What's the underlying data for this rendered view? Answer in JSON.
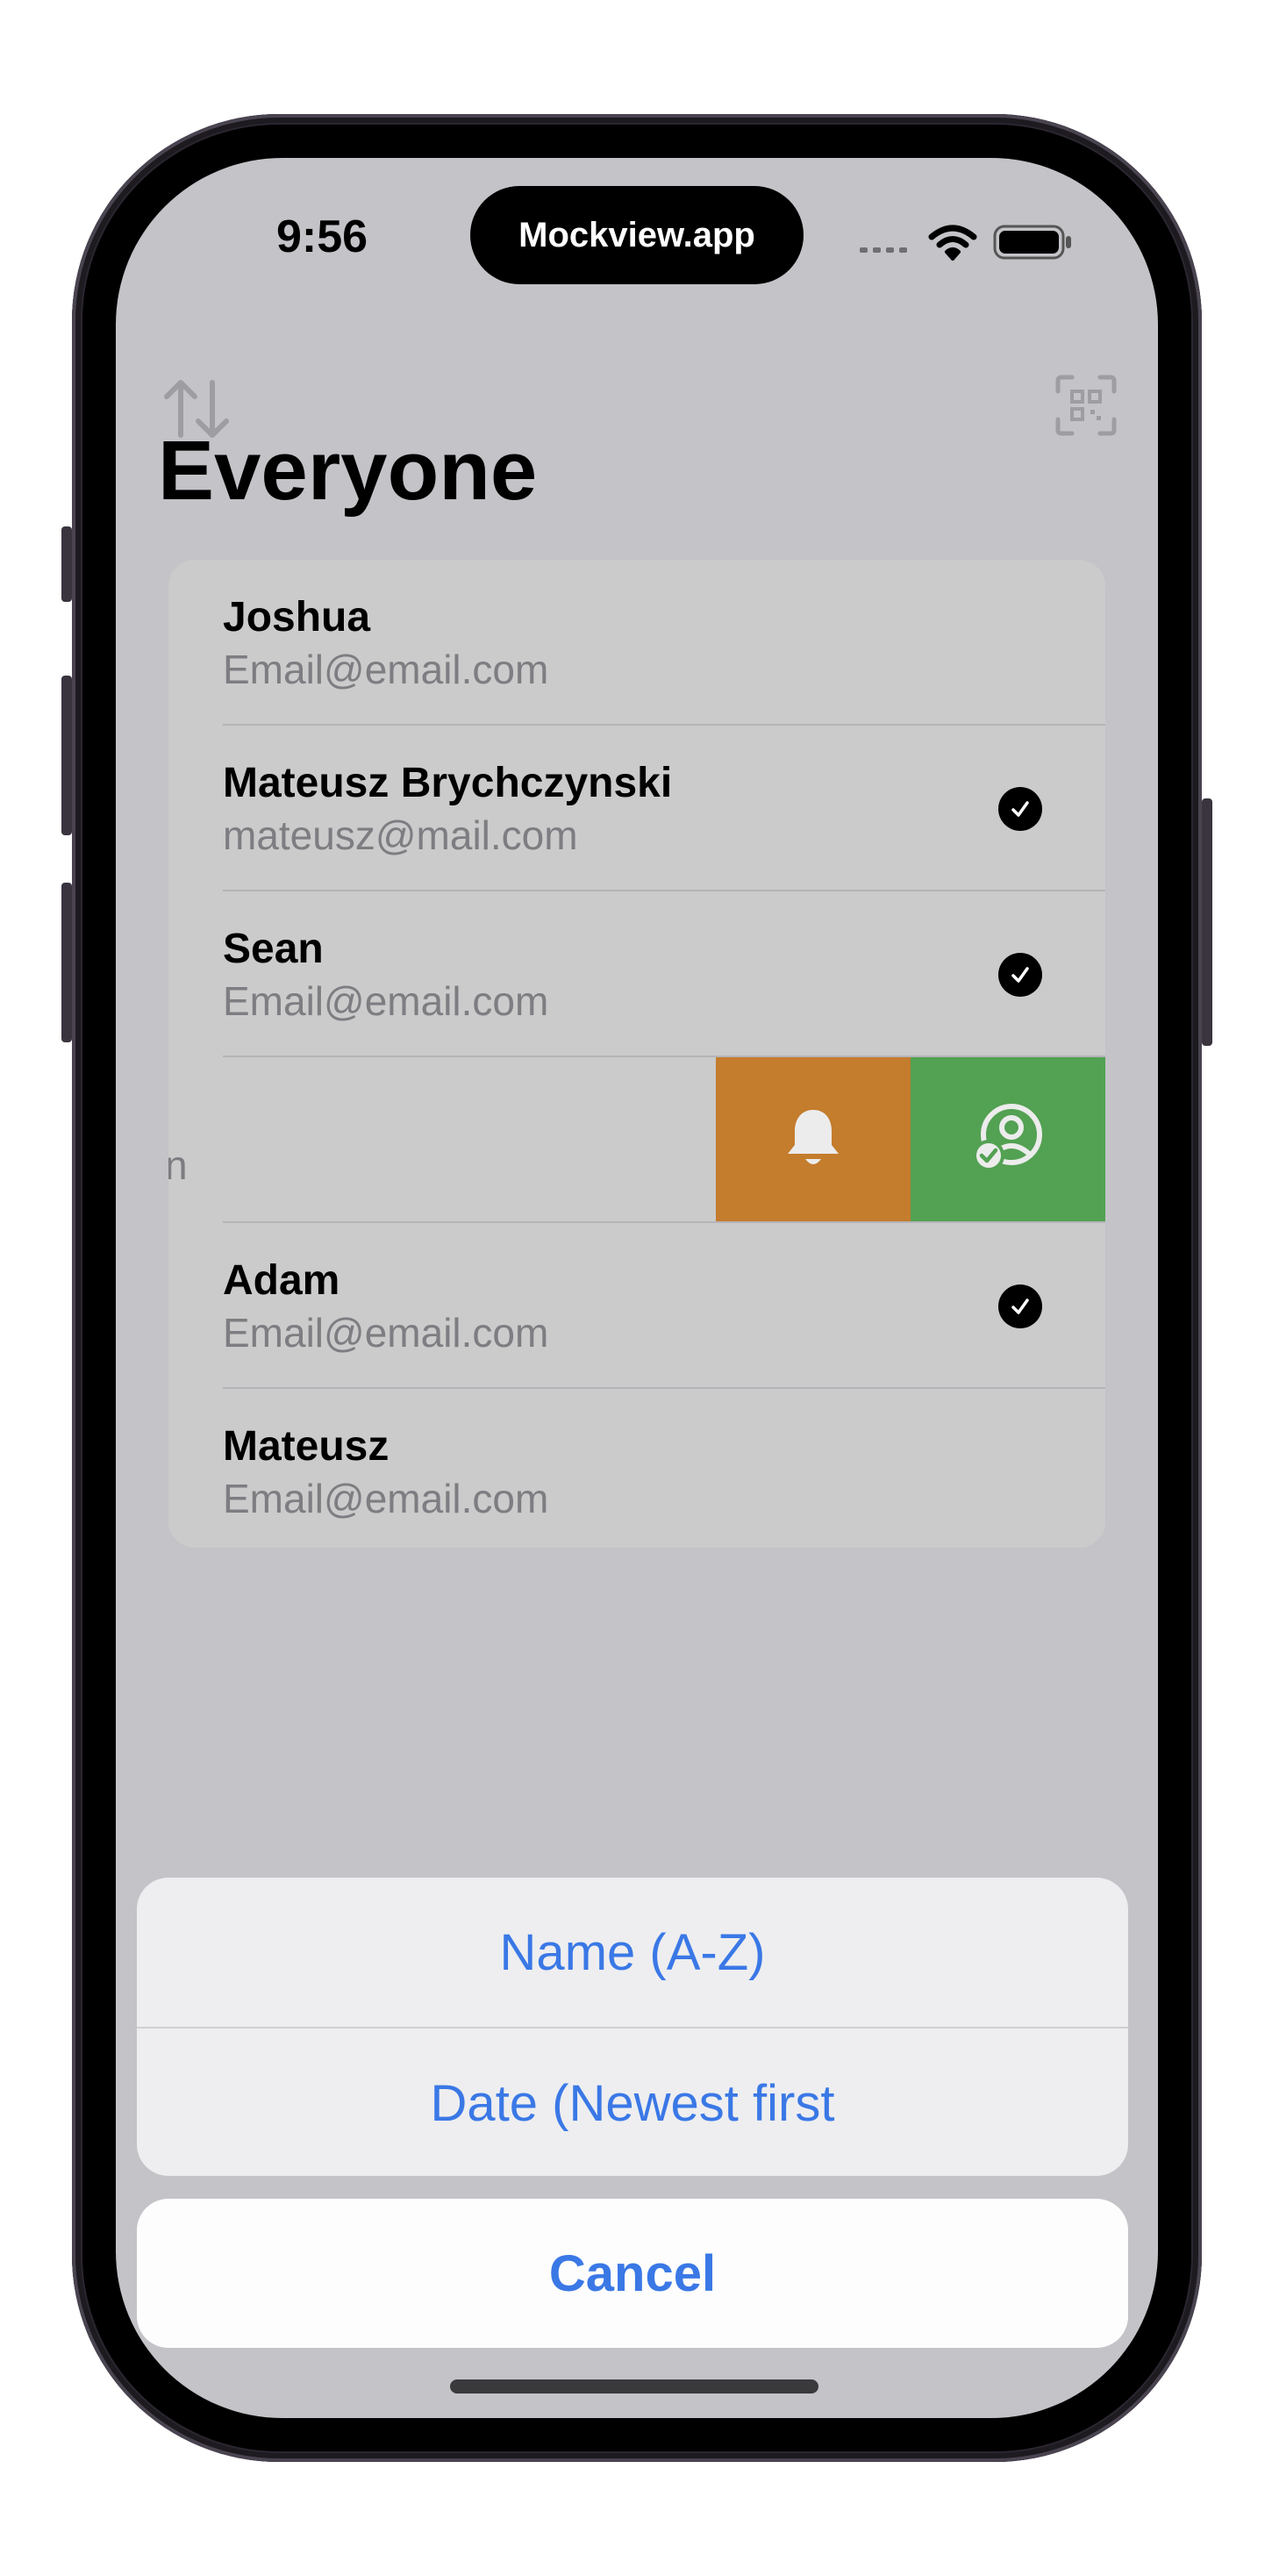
{
  "status_bar": {
    "time": "9:56",
    "island_label": "Mockview.app"
  },
  "toolbar": {
    "sort_icon": "sort-arrows-icon",
    "scan_icon": "qr-scan-icon"
  },
  "page": {
    "title": "Everyone"
  },
  "contacts": [
    {
      "name": "Joshua",
      "email": "Email@email.com",
      "checked": false
    },
    {
      "name": "Mateusz Brychczynski",
      "email": "mateusz@mail.com",
      "checked": true
    },
    {
      "name": "Sean",
      "email": "Email@email.com",
      "checked": true
    },
    {
      "name": "",
      "email": "n",
      "checked": false
    },
    {
      "name": "Adam",
      "email": "Email@email.com",
      "checked": true
    },
    {
      "name": "Mateusz",
      "email": "Email@email.com",
      "checked": false
    }
  ],
  "swipe_actions": {
    "notify_color": "#c47c2d",
    "approve_color": "#53a153",
    "notify_icon": "bell-icon",
    "approve_icon": "person-check-icon"
  },
  "action_sheet": {
    "options": [
      "Name (A-Z)",
      "Date (Newest first"
    ],
    "cancel_label": "Cancel",
    "accent_color": "#3a78e6"
  }
}
